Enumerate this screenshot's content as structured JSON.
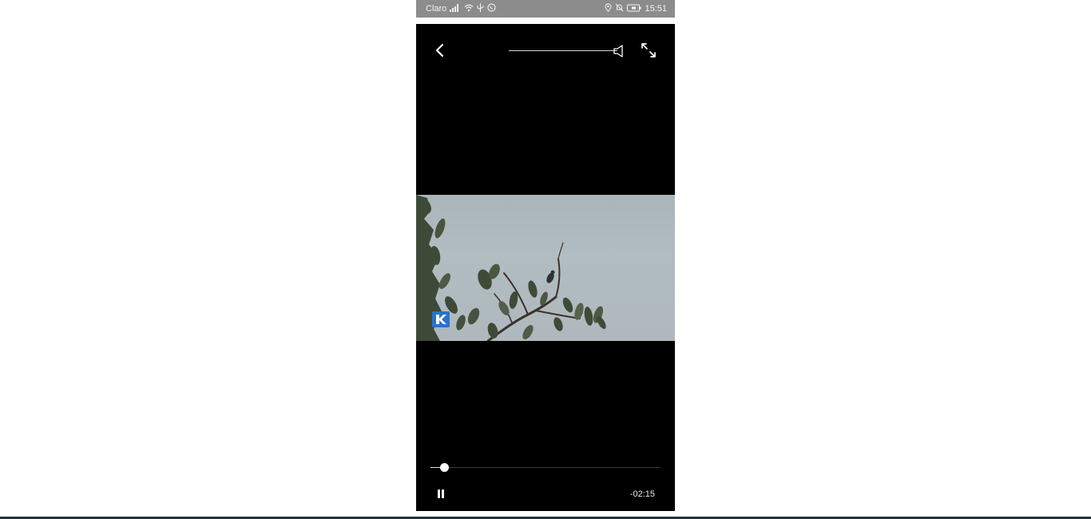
{
  "status_bar": {
    "carrier": "Claro",
    "time": "15:51",
    "icons_left": [
      "signal-icon",
      "wifi-icon",
      "usb-icon",
      "whatsapp-icon"
    ],
    "icons_right": [
      "location-icon",
      "bell-muted-icon",
      "battery-icon"
    ]
  },
  "player": {
    "volume_level": 1.0,
    "progress": 0.06,
    "time_remaining": "-02:15",
    "state": "playing"
  },
  "icons": {
    "back": "back-chevron-icon",
    "speaker": "speaker-icon",
    "fullscreen": "fullscreen-expand-icon",
    "pause": "pause-icon",
    "channel_logo": "channel-logo-icon"
  },
  "colors": {
    "player_background": "#000000",
    "status_bar": "#8c8c8c",
    "video_sky": "#b0bbbf",
    "controls": "#ffffff"
  }
}
